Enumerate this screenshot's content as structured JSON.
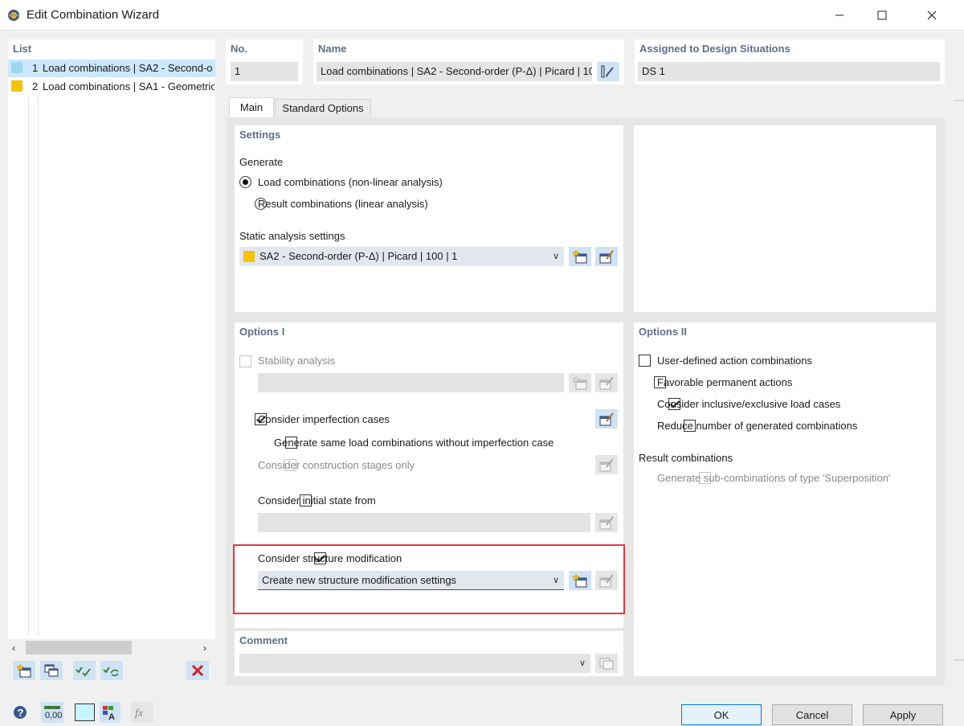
{
  "window": {
    "title": "Edit Combination Wizard"
  },
  "list": {
    "header": "List",
    "items": [
      {
        "num": "1",
        "label": "Load combinations | SA2 - Second-o",
        "color": "#9ed8f0",
        "selected": true
      },
      {
        "num": "2",
        "label": "Load combinations | SA1 - Geometric",
        "color": "#f5c400",
        "selected": false
      }
    ]
  },
  "no": {
    "label": "No.",
    "value": "1"
  },
  "name": {
    "label": "Name",
    "value": "Load combinations | SA2 - Second-order (P-Δ) | Picard | 10"
  },
  "design_situations": {
    "label": "Assigned to Design Situations",
    "value": "DS 1"
  },
  "tabs": [
    {
      "label": "Main",
      "active": true
    },
    {
      "label": "Standard Options",
      "active": false
    }
  ],
  "settings": {
    "header": "Settings",
    "generate_label": "Generate",
    "option_nonlinear": "Load combinations (non-linear analysis)",
    "option_linear": "Result combinations (linear analysis)",
    "static_label": "Static analysis settings",
    "static_value": "SA2 - Second-order (P-Δ) | Picard | 100 | 1",
    "static_color": "#f5c400"
  },
  "options1": {
    "header": "Options I",
    "stability": "Stability analysis",
    "imperfection": "Consider imperfection cases",
    "generate_same": "Generate same load combinations without imperfection case",
    "construction": "Consider construction stages only",
    "initial_state": "Consider initial state from",
    "structure_mod": "Consider structure modification",
    "structure_mod_value": "Create new structure modification settings"
  },
  "options2": {
    "header": "Options II",
    "user_defined": "User-defined action combinations",
    "favorable": "Favorable permanent actions",
    "inclusive": "Consider inclusive/exclusive load cases",
    "reduce": "Reduce number of generated combinations",
    "result_label": "Result combinations",
    "sub_combinations": "Generate sub-combinations of type 'Superposition'"
  },
  "comment": {
    "header": "Comment",
    "value": ""
  },
  "buttons": {
    "ok": "OK",
    "cancel": "Cancel",
    "apply": "Apply"
  },
  "highlight_color": "#e0393e"
}
